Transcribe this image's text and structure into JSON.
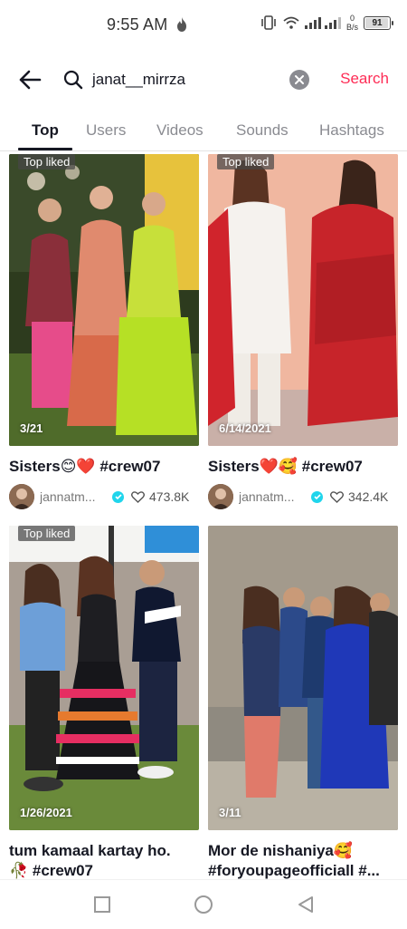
{
  "status_bar": {
    "time": "9:55 AM",
    "net_speed_value": "0",
    "net_speed_unit": "B/s",
    "battery_level": "91"
  },
  "search": {
    "query": "janat__mirrza",
    "action_label": "Search"
  },
  "tabs": [
    {
      "label": "Top",
      "active": true
    },
    {
      "label": "Users",
      "active": false
    },
    {
      "label": "Videos",
      "active": false
    },
    {
      "label": "Sounds",
      "active": false
    },
    {
      "label": "Hashtags",
      "active": false
    }
  ],
  "videos": [
    {
      "badge": "Top liked",
      "date": "3/21",
      "caption": "Sisters😊❤️ #crew07",
      "author": "jannatm...",
      "likes": "473.8K"
    },
    {
      "badge": "Top liked",
      "date": "6/14/2021",
      "caption": "Sisters❤️🥰 #crew07",
      "author": "jannatm...",
      "likes": "342.4K"
    },
    {
      "badge": "Top liked",
      "date": "1/26/2021",
      "caption_line1": "tum kamaal kartay ho.",
      "caption_line2": "🥀 #crew07"
    },
    {
      "date": "3/11",
      "caption_line1": "Mor de nishaniya🥰",
      "caption_line2": "#foryoupageofficiall #..."
    }
  ],
  "colors": {
    "accent": "#fe2c55",
    "verified": "#20d5ec",
    "text_primary": "#161823",
    "text_secondary": "#8a8b91"
  }
}
